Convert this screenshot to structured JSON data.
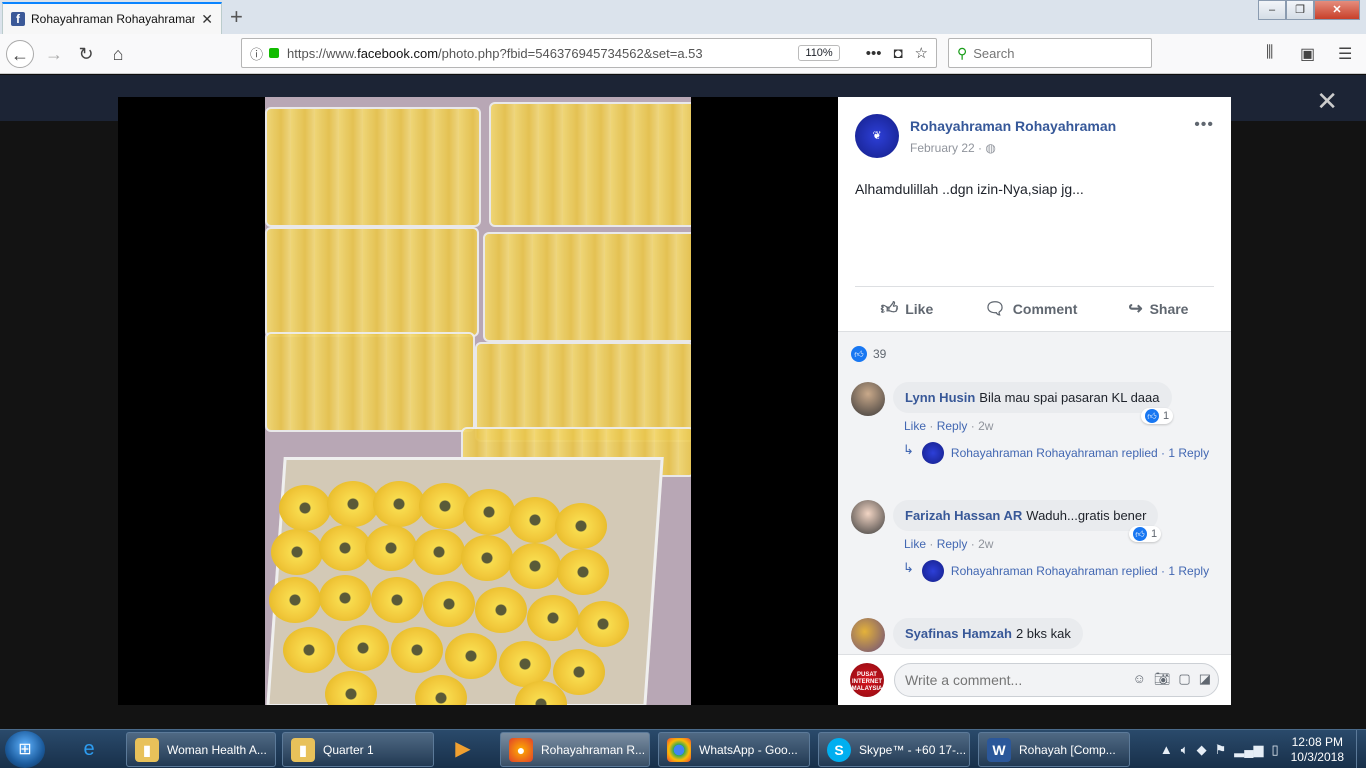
{
  "browser": {
    "tab_title": "Rohayahraman Rohayahraman",
    "url_prefix": "https://www.",
    "url_domain": "facebook.com",
    "url_rest": "/photo.php?fbid=546376945734562&set=a.53",
    "zoom": "110%",
    "search_placeholder": "Search"
  },
  "post": {
    "author": "Rohayahraman Rohayahraman",
    "date": "February 22",
    "date_sep": "·",
    "text": "Alhamdulillah ..dgn izin-Nya,siap jg...",
    "actions": {
      "like": "Like",
      "comment": "Comment",
      "share": "Share"
    },
    "like_count": "39"
  },
  "comments": [
    {
      "name": "Lynn Husin",
      "text": "Bila mau spai pasaran KL daaa",
      "reactions": "1",
      "like": "Like",
      "reply": "Reply",
      "ago": "2w",
      "replied_by": "Rohayahraman Rohayahraman replied",
      "replies": "1 Reply"
    },
    {
      "name": "Farizah Hassan AR",
      "text": "Waduh...gratis bener",
      "reactions": "1",
      "like": "Like",
      "reply": "Reply",
      "ago": "2w",
      "replied_by": "Rohayahraman Rohayahraman replied",
      "replies": "1 Reply"
    },
    {
      "name": "Syafinas Hamzah",
      "text": "2 bks kak"
    }
  ],
  "composer": {
    "placeholder": "Write a comment..."
  },
  "taskbar": {
    "items": [
      "Woman Health A...",
      "Quarter 1",
      "Rohayahraman R...",
      "WhatsApp - Goo...",
      "Skype™ - +60 17-...",
      "Rohayah [Comp..."
    ],
    "time": "12:08 PM",
    "date": "10/3/2018"
  },
  "colors": {
    "facebook_blue": "#365899",
    "link_blue": "#4267b2",
    "like_blue": "#1877f2",
    "panel_gray": "#f2f3f5"
  }
}
